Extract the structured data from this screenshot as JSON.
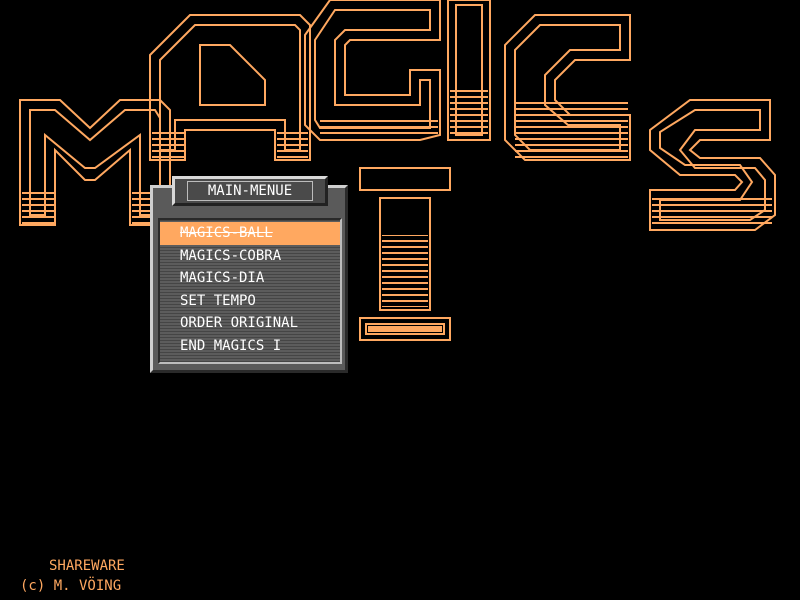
{
  "logo": {
    "text": "MAGICS I",
    "outline_color": "#ffa860",
    "fill_color": "#ffa860"
  },
  "menu": {
    "title": "MAIN-MENUE",
    "items": [
      {
        "label": "MAGICS-BALL",
        "selected": true
      },
      {
        "label": "MAGICS-COBRA",
        "selected": false
      },
      {
        "label": "MAGICS-DIA",
        "selected": false
      },
      {
        "label": "SET TEMPO",
        "selected": false
      },
      {
        "label": "ORDER ORIGINAL",
        "selected": false
      },
      {
        "label": "END MAGICS I",
        "selected": false
      }
    ]
  },
  "footer": {
    "shareware": "SHAREWARE",
    "copyright": "(c) M. VÖING"
  },
  "colors": {
    "background": "#000000",
    "accent": "#ffa860",
    "menu_panel": "#5a5a5a",
    "menu_text": "#ffffff"
  }
}
